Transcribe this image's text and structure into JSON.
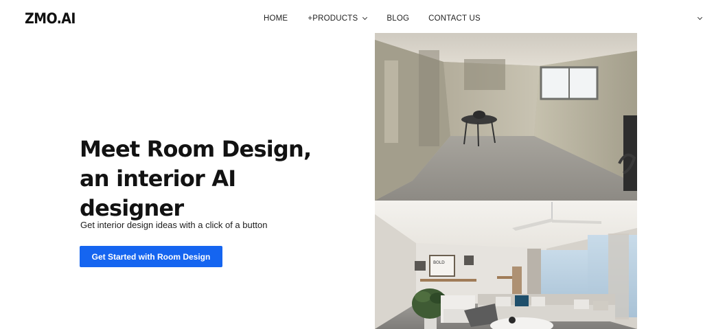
{
  "header": {
    "logo": "ZMO.AI",
    "nav": {
      "home": "HOME",
      "products": "+PRODUCTS",
      "blog": "BLOG",
      "contact": "CONTACT US"
    }
  },
  "hero": {
    "headline_line1": "Meet Room Design,",
    "headline_line2": "an interior AI",
    "headline_line3": "designer",
    "subtitle": "Get interior design ideas with a click of a button",
    "cta_label": "Get Started with Room Design"
  },
  "images": {
    "after_poster_text": "BOLD SIMPLE BAKERY"
  },
  "colors": {
    "cta_background": "#1565f0",
    "text": "#121212"
  }
}
